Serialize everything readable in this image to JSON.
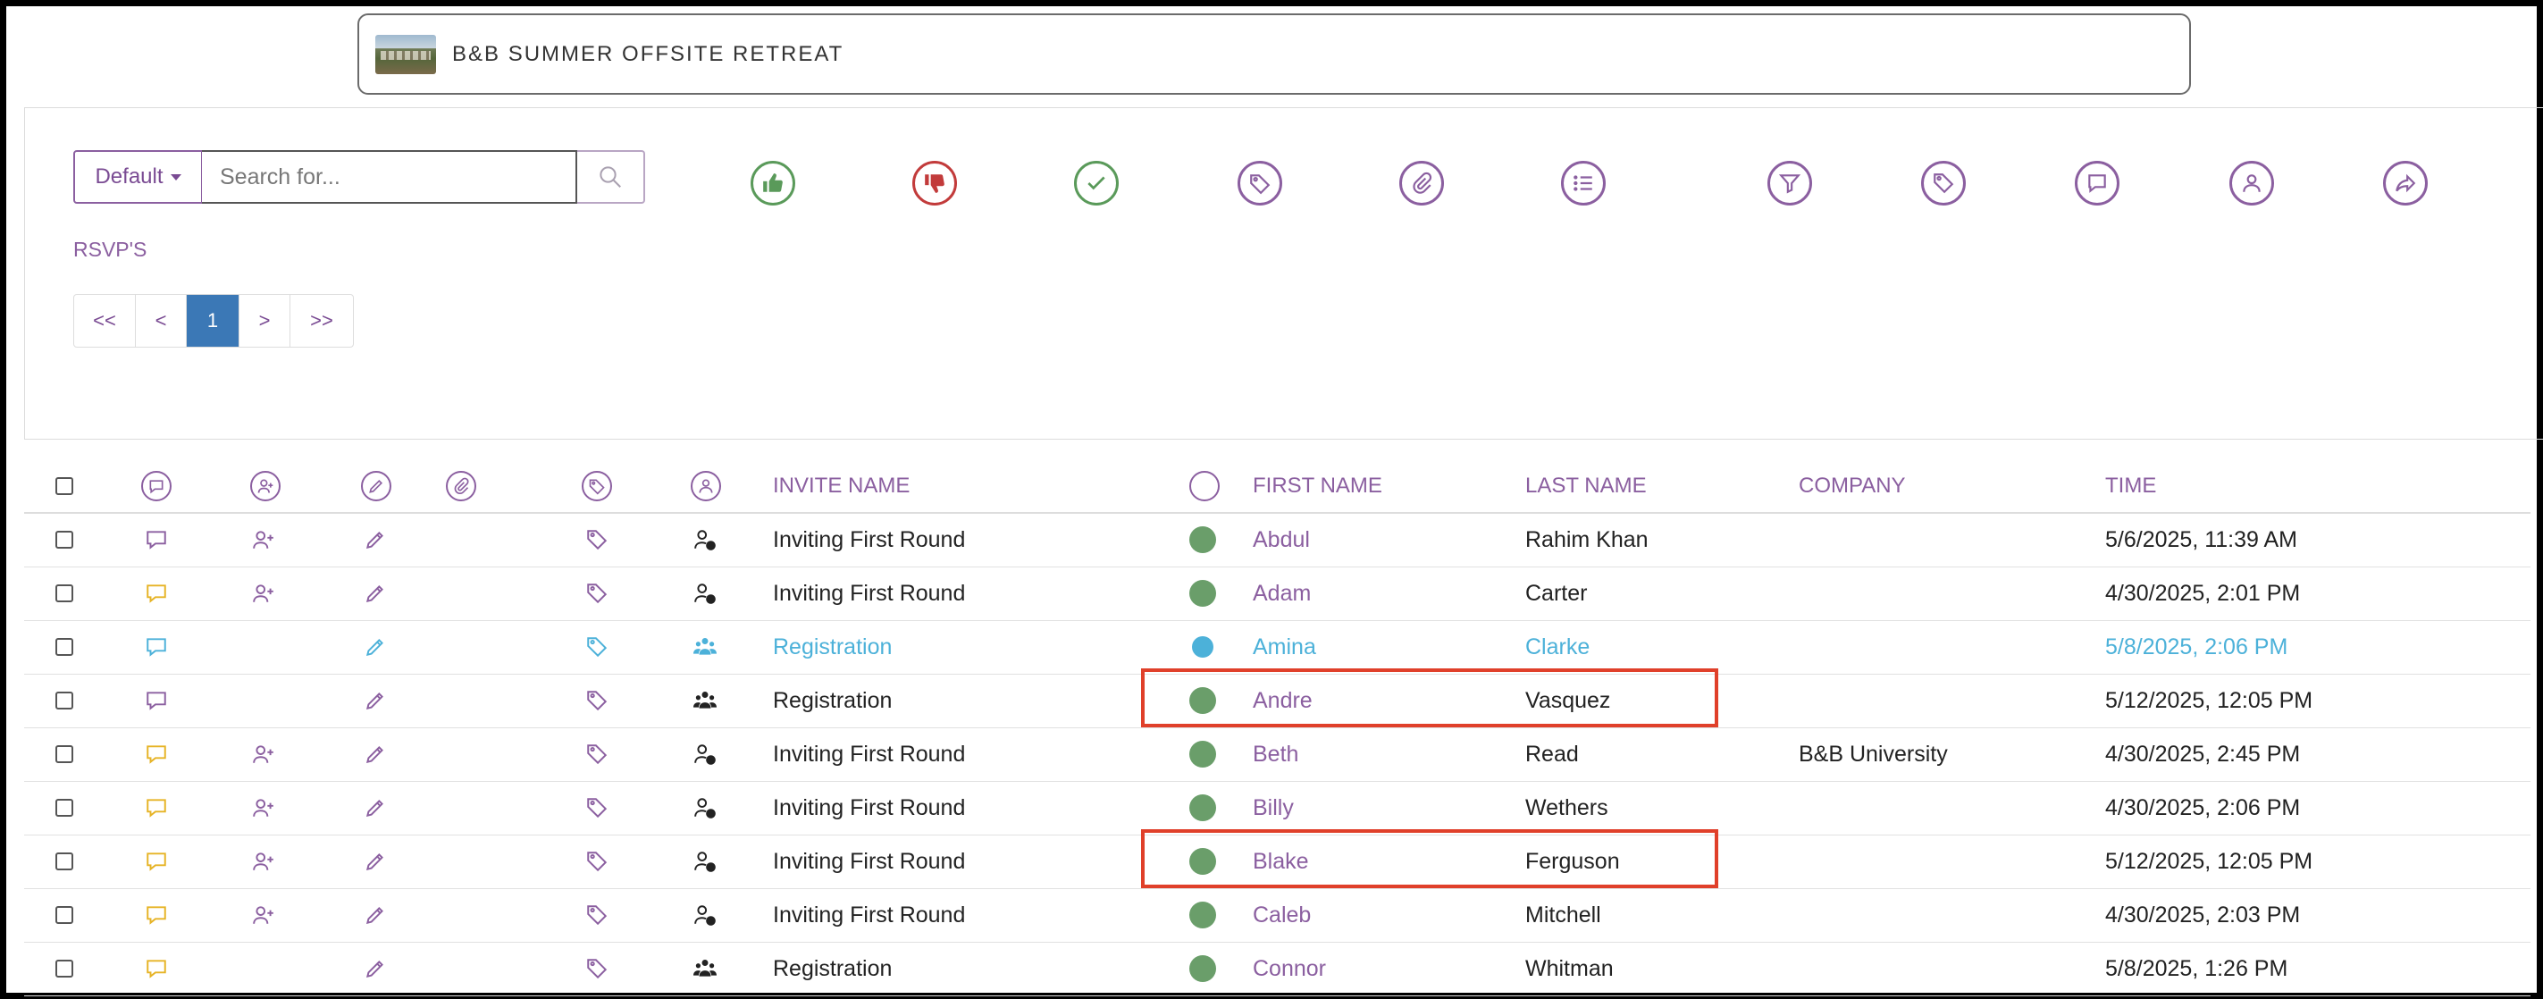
{
  "event": {
    "title": "B&B SUMMER OFFSITE RETREAT"
  },
  "controls": {
    "view_select": "Default",
    "search_placeholder": "Search for...",
    "rsvp_label": "RSVP'S",
    "pager": [
      "<<",
      "<",
      "1",
      ">",
      ">>"
    ]
  },
  "toolbar": [
    {
      "name": "thumbs-up-icon",
      "color": "#5a9a5a"
    },
    {
      "name": "thumbs-down-icon",
      "color": "#c23b3b"
    },
    {
      "name": "check-icon",
      "color": "#5a9a5a"
    },
    {
      "name": "tag-icon",
      "color": "#8b5fa0"
    },
    {
      "name": "paperclip-icon",
      "color": "#8b5fa0"
    },
    {
      "name": "list-icon",
      "color": "#8b5fa0"
    },
    {
      "name": "filter-icon",
      "color": "#8b5fa0"
    },
    {
      "name": "tags-icon",
      "color": "#8b5fa0"
    },
    {
      "name": "message-icon",
      "color": "#8b5fa0"
    },
    {
      "name": "user-icon",
      "color": "#8b5fa0"
    },
    {
      "name": "share-icon",
      "color": "#8b5fa0"
    }
  ],
  "table": {
    "headers": {
      "invite_name": "INVITE NAME",
      "first_name": "FIRST NAME",
      "last_name": "LAST NAME",
      "company": "COMPANY",
      "time": "TIME"
    },
    "rows": [
      {
        "invite": "Inviting First Round",
        "first": "Abdul",
        "last": "Rahim Khan",
        "company": "",
        "time": "5/6/2025, 11:39 AM",
        "comment_color": "#8b5fa0",
        "add_user": true,
        "type_icon": "user-clock-icon",
        "status_color": "#6a9e6a",
        "highlight": false
      },
      {
        "invite": "Inviting First Round",
        "first": "Adam",
        "last": "Carter",
        "company": "",
        "time": "4/30/2025, 2:01 PM",
        "comment_color": "#e6b325",
        "add_user": true,
        "type_icon": "user-clock-icon",
        "status_color": "#6a9e6a",
        "highlight": false
      },
      {
        "invite": "Registration",
        "first": "Amina",
        "last": "Clarke",
        "company": "",
        "time": "5/8/2025, 2:06 PM",
        "comment_color": "#4cb1d9",
        "add_user": false,
        "type_icon": "users-icon",
        "status_color": "#4cb1d9",
        "highlight": true
      },
      {
        "invite": "Registration",
        "first": "Andre",
        "last": "Vasquez",
        "company": "",
        "time": "5/12/2025, 12:05 PM",
        "comment_color": "#8b5fa0",
        "add_user": false,
        "type_icon": "users-icon",
        "status_color": "#6a9e6a",
        "highlight": false
      },
      {
        "invite": "Inviting First Round",
        "first": "Beth",
        "last": "Read",
        "company": "B&B University",
        "time": "4/30/2025, 2:45 PM",
        "comment_color": "#e6b325",
        "add_user": true,
        "type_icon": "user-clock-icon",
        "status_color": "#6a9e6a",
        "highlight": false
      },
      {
        "invite": "Inviting First Round",
        "first": "Billy",
        "last": "Wethers",
        "company": "",
        "time": "4/30/2025, 2:06 PM",
        "comment_color": "#e6b325",
        "add_user": true,
        "type_icon": "user-clock-icon",
        "status_color": "#6a9e6a",
        "highlight": false
      },
      {
        "invite": "Inviting First Round",
        "first": "Blake",
        "last": "Ferguson",
        "company": "",
        "time": "5/12/2025, 12:05 PM",
        "comment_color": "#e6b325",
        "add_user": true,
        "type_icon": "user-clock-icon",
        "status_color": "#6a9e6a",
        "highlight": false
      },
      {
        "invite": "Inviting First Round",
        "first": "Caleb",
        "last": "Mitchell",
        "company": "",
        "time": "4/30/2025, 2:03 PM",
        "comment_color": "#e6b325",
        "add_user": true,
        "type_icon": "user-clock-icon",
        "status_color": "#6a9e6a",
        "highlight": false
      },
      {
        "invite": "Registration",
        "first": "Connor",
        "last": "Whitman",
        "company": "",
        "time": "5/8/2025, 1:26 PM",
        "comment_color": "#e6b325",
        "add_user": false,
        "type_icon": "users-icon",
        "status_color": "#6a9e6a",
        "highlight": false
      }
    ]
  },
  "callouts": {
    "color": "#e0402a",
    "rows": [
      "Andre",
      "Blake"
    ]
  }
}
